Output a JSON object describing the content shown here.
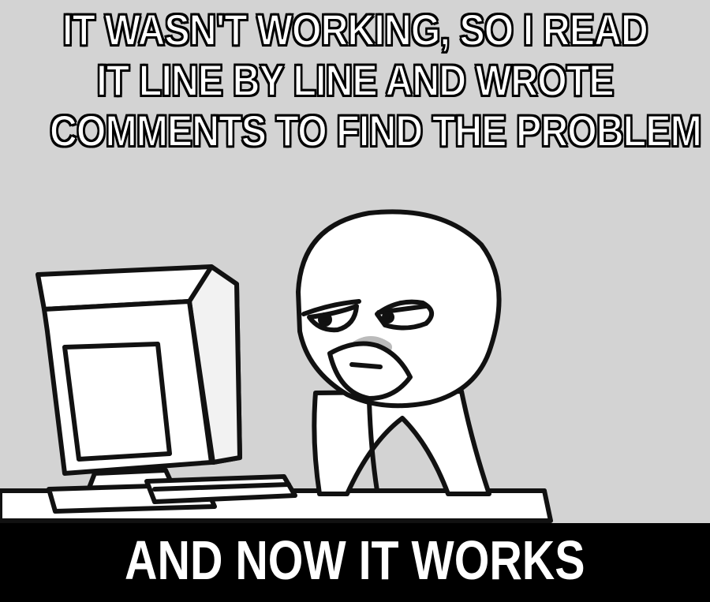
{
  "meme": {
    "top_caption": [
      "IT WASN'T WORKING, SO I READ",
      "IT LINE BY LINE AND WROTE",
      "COMMENTS TO FIND THE PROBLEM"
    ],
    "bottom_caption": "AND NOW IT WORKS",
    "illustration": "computer-guy-meme",
    "colors": {
      "background": "#d3d3d3",
      "caption_text": "#ffffff",
      "caption_outline": "#000000",
      "bottom_bar": "#000000",
      "line_art": "#111111",
      "fill": "#ffffff"
    }
  }
}
